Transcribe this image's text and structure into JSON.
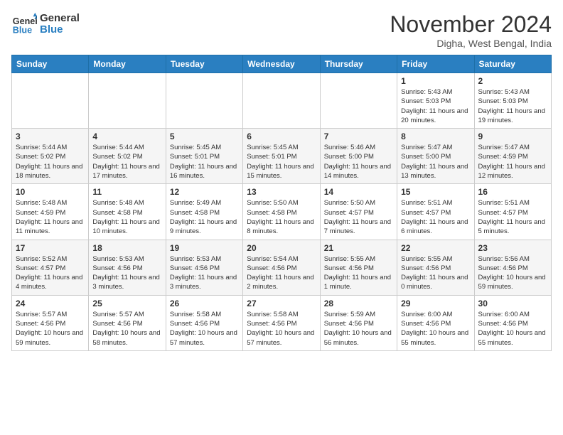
{
  "header": {
    "logo_line1": "General",
    "logo_line2": "Blue",
    "month_title": "November 2024",
    "location": "Digha, West Bengal, India"
  },
  "weekdays": [
    "Sunday",
    "Monday",
    "Tuesday",
    "Wednesday",
    "Thursday",
    "Friday",
    "Saturday"
  ],
  "weeks": [
    [
      {
        "day": "",
        "info": ""
      },
      {
        "day": "",
        "info": ""
      },
      {
        "day": "",
        "info": ""
      },
      {
        "day": "",
        "info": ""
      },
      {
        "day": "",
        "info": ""
      },
      {
        "day": "1",
        "info": "Sunrise: 5:43 AM\nSunset: 5:03 PM\nDaylight: 11 hours and 20 minutes."
      },
      {
        "day": "2",
        "info": "Sunrise: 5:43 AM\nSunset: 5:03 PM\nDaylight: 11 hours and 19 minutes."
      }
    ],
    [
      {
        "day": "3",
        "info": "Sunrise: 5:44 AM\nSunset: 5:02 PM\nDaylight: 11 hours and 18 minutes."
      },
      {
        "day": "4",
        "info": "Sunrise: 5:44 AM\nSunset: 5:02 PM\nDaylight: 11 hours and 17 minutes."
      },
      {
        "day": "5",
        "info": "Sunrise: 5:45 AM\nSunset: 5:01 PM\nDaylight: 11 hours and 16 minutes."
      },
      {
        "day": "6",
        "info": "Sunrise: 5:45 AM\nSunset: 5:01 PM\nDaylight: 11 hours and 15 minutes."
      },
      {
        "day": "7",
        "info": "Sunrise: 5:46 AM\nSunset: 5:00 PM\nDaylight: 11 hours and 14 minutes."
      },
      {
        "day": "8",
        "info": "Sunrise: 5:47 AM\nSunset: 5:00 PM\nDaylight: 11 hours and 13 minutes."
      },
      {
        "day": "9",
        "info": "Sunrise: 5:47 AM\nSunset: 4:59 PM\nDaylight: 11 hours and 12 minutes."
      }
    ],
    [
      {
        "day": "10",
        "info": "Sunrise: 5:48 AM\nSunset: 4:59 PM\nDaylight: 11 hours and 11 minutes."
      },
      {
        "day": "11",
        "info": "Sunrise: 5:48 AM\nSunset: 4:58 PM\nDaylight: 11 hours and 10 minutes."
      },
      {
        "day": "12",
        "info": "Sunrise: 5:49 AM\nSunset: 4:58 PM\nDaylight: 11 hours and 9 minutes."
      },
      {
        "day": "13",
        "info": "Sunrise: 5:50 AM\nSunset: 4:58 PM\nDaylight: 11 hours and 8 minutes."
      },
      {
        "day": "14",
        "info": "Sunrise: 5:50 AM\nSunset: 4:57 PM\nDaylight: 11 hours and 7 minutes."
      },
      {
        "day": "15",
        "info": "Sunrise: 5:51 AM\nSunset: 4:57 PM\nDaylight: 11 hours and 6 minutes."
      },
      {
        "day": "16",
        "info": "Sunrise: 5:51 AM\nSunset: 4:57 PM\nDaylight: 11 hours and 5 minutes."
      }
    ],
    [
      {
        "day": "17",
        "info": "Sunrise: 5:52 AM\nSunset: 4:57 PM\nDaylight: 11 hours and 4 minutes."
      },
      {
        "day": "18",
        "info": "Sunrise: 5:53 AM\nSunset: 4:56 PM\nDaylight: 11 hours and 3 minutes."
      },
      {
        "day": "19",
        "info": "Sunrise: 5:53 AM\nSunset: 4:56 PM\nDaylight: 11 hours and 3 minutes."
      },
      {
        "day": "20",
        "info": "Sunrise: 5:54 AM\nSunset: 4:56 PM\nDaylight: 11 hours and 2 minutes."
      },
      {
        "day": "21",
        "info": "Sunrise: 5:55 AM\nSunset: 4:56 PM\nDaylight: 11 hours and 1 minute."
      },
      {
        "day": "22",
        "info": "Sunrise: 5:55 AM\nSunset: 4:56 PM\nDaylight: 11 hours and 0 minutes."
      },
      {
        "day": "23",
        "info": "Sunrise: 5:56 AM\nSunset: 4:56 PM\nDaylight: 10 hours and 59 minutes."
      }
    ],
    [
      {
        "day": "24",
        "info": "Sunrise: 5:57 AM\nSunset: 4:56 PM\nDaylight: 10 hours and 59 minutes."
      },
      {
        "day": "25",
        "info": "Sunrise: 5:57 AM\nSunset: 4:56 PM\nDaylight: 10 hours and 58 minutes."
      },
      {
        "day": "26",
        "info": "Sunrise: 5:58 AM\nSunset: 4:56 PM\nDaylight: 10 hours and 57 minutes."
      },
      {
        "day": "27",
        "info": "Sunrise: 5:58 AM\nSunset: 4:56 PM\nDaylight: 10 hours and 57 minutes."
      },
      {
        "day": "28",
        "info": "Sunrise: 5:59 AM\nSunset: 4:56 PM\nDaylight: 10 hours and 56 minutes."
      },
      {
        "day": "29",
        "info": "Sunrise: 6:00 AM\nSunset: 4:56 PM\nDaylight: 10 hours and 55 minutes."
      },
      {
        "day": "30",
        "info": "Sunrise: 6:00 AM\nSunset: 4:56 PM\nDaylight: 10 hours and 55 minutes."
      }
    ]
  ]
}
